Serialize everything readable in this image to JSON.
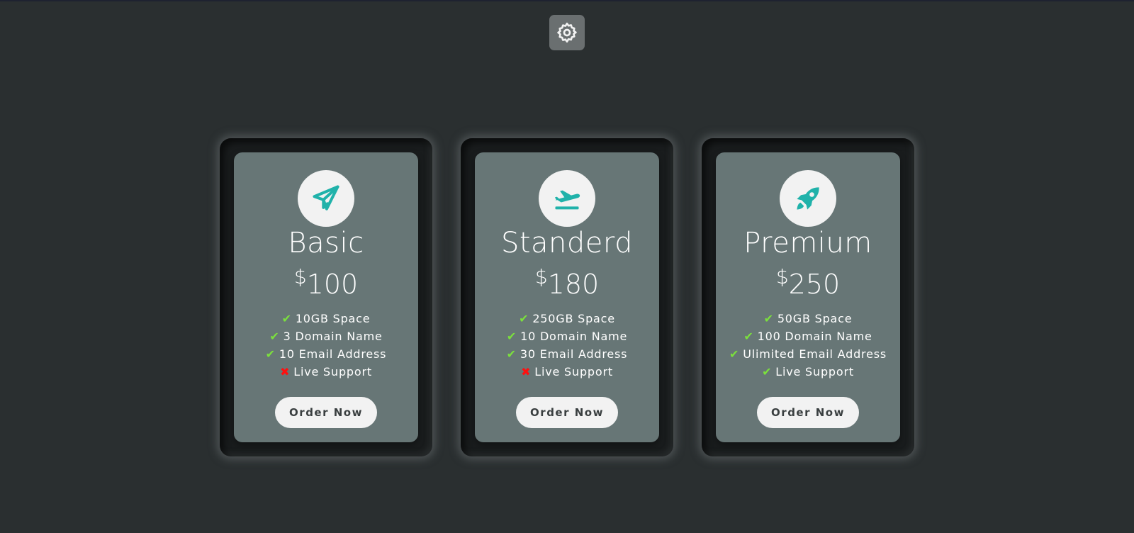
{
  "settings": {
    "icon": "gear-icon"
  },
  "accent_color": "#20b2aa",
  "check_color": "#7be03d",
  "cross_color": "#ff1010",
  "plans": [
    {
      "icon": "paper-plane-icon",
      "name": "Basic",
      "currency": "$",
      "price": "100",
      "features": [
        {
          "included": true,
          "text": "10GB Space"
        },
        {
          "included": true,
          "text": "3 Domain Name"
        },
        {
          "included": true,
          "text": "10 Email Address"
        },
        {
          "included": false,
          "text": "Live Support"
        }
      ],
      "button_label": "Order Now"
    },
    {
      "icon": "plane-departure-icon",
      "name": "Standerd",
      "currency": "$",
      "price": "180",
      "features": [
        {
          "included": true,
          "text": "250GB Space"
        },
        {
          "included": true,
          "text": "10 Domain Name"
        },
        {
          "included": true,
          "text": "30 Email Address"
        },
        {
          "included": false,
          "text": "Live Support"
        }
      ],
      "button_label": "Order Now"
    },
    {
      "icon": "rocket-icon",
      "name": "Premium",
      "currency": "$",
      "price": "250",
      "features": [
        {
          "included": true,
          "text": "50GB Space"
        },
        {
          "included": true,
          "text": "100 Domain Name"
        },
        {
          "included": true,
          "text": "Ulimited Email Address"
        },
        {
          "included": true,
          "text": "Live Support"
        }
      ],
      "button_label": "Order Now"
    }
  ]
}
